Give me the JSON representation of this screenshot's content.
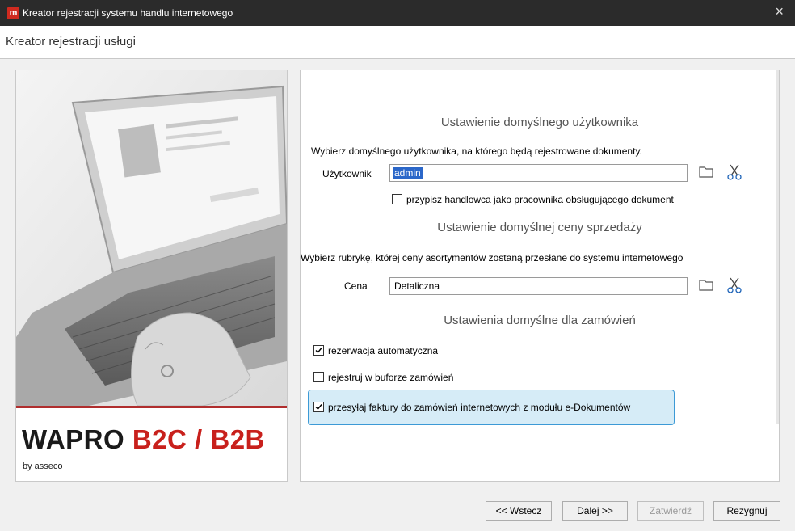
{
  "window": {
    "icon_letter": "m",
    "title": "Kreator rejestracji systemu handlu internetowego",
    "close_glyph": "×"
  },
  "subheader": {
    "title": "Kreator rejestracji usługi"
  },
  "branding": {
    "brand_prefix": "WAPRO ",
    "brand_highlight": "B2C / B2B",
    "byline": "by asseco",
    "brand_color": "#c8201c"
  },
  "user_section": {
    "heading": "Ustawienie domyślnego użytkownika",
    "description": "Wybierz domyślnego użytkownika, na którego będą rejestrowane dokumenty.",
    "field_label": "Użytkownik",
    "field_value": "admin",
    "checkbox_label": "przypisz handlowca jako pracownika obsługującego dokument",
    "checkbox_checked": false
  },
  "price_section": {
    "heading": "Ustawienie domyślnej ceny sprzedaży",
    "description": "Wybierz rubrykę, której ceny asortymentów zostaną przesłane do systemu internetowego",
    "field_label": "Cena",
    "field_value": "Detaliczna"
  },
  "orders_section": {
    "heading": "Ustawienia domyślne dla zamówień",
    "options": [
      {
        "label": "rezerwacja automatyczna",
        "checked": true
      },
      {
        "label": "rejestruj w buforze zamówień",
        "checked": false
      },
      {
        "label": "przesyłaj faktury do zamówień internetowych z modułu e-Dokumentów",
        "checked": true
      }
    ]
  },
  "buttons": {
    "back": "<< Wstecz",
    "next": "Dalej >>",
    "confirm": "Zatwierdź",
    "cancel": "Rezygnuj"
  },
  "colors": {
    "titlebar": "#2b2b2b",
    "highlight_fill": "#d6ecf7",
    "highlight_border": "#3c9ad6",
    "selection": "#2b67c9"
  }
}
